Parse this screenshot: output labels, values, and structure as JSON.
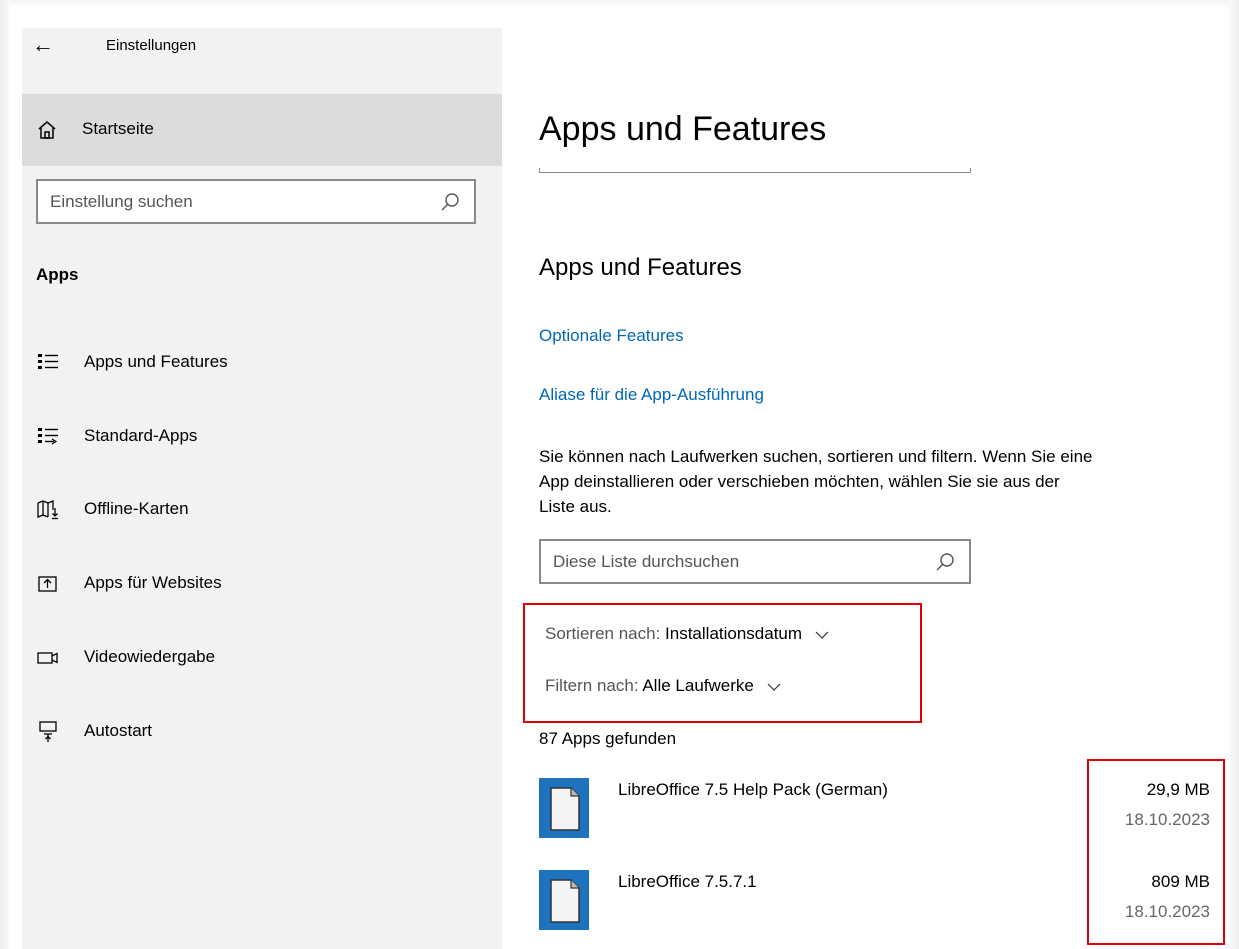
{
  "window": {
    "title": "Einstellungen",
    "back_glyph": "←"
  },
  "sidebar": {
    "home_label": "Startseite",
    "search_placeholder": "Einstellung suchen",
    "section_label": "Apps",
    "items": [
      {
        "label": "Apps und Features",
        "icon": "apps-features-icon",
        "selected": true
      },
      {
        "label": "Standard-Apps",
        "icon": "default-apps-icon"
      },
      {
        "label": "Offline-Karten",
        "icon": "offline-maps-icon"
      },
      {
        "label": "Apps für Websites",
        "icon": "apps-websites-icon"
      },
      {
        "label": "Videowiedergabe",
        "icon": "video-playback-icon"
      },
      {
        "label": "Autostart",
        "icon": "startup-icon"
      }
    ]
  },
  "main": {
    "page_title": "Apps und Features",
    "section_title": "Apps und Features",
    "links": {
      "optional_features": "Optionale Features",
      "app_aliases": "Aliase für die App-Ausführung"
    },
    "description_line1": "Sie können nach Laufwerken suchen, sortieren und filtern. Wenn Sie eine",
    "description_line2": "App deinstallieren oder verschieben möchten, wählen Sie sie aus der",
    "description_line3": "Liste aus.",
    "list_search_placeholder": "Diese Liste durchsuchen",
    "sort": {
      "label": "Sortieren nach:",
      "value": "Installationsdatum"
    },
    "filter": {
      "label": "Filtern nach:",
      "value": "Alle Laufwerke"
    },
    "apps_found": "87 Apps gefunden",
    "apps": [
      {
        "name": "LibreOffice 7.5 Help Pack (German)",
        "size": "29,9 MB",
        "date": "18.10.2023"
      },
      {
        "name": "LibreOffice 7.5.7.1",
        "size": "809 MB",
        "date": "18.10.2023"
      }
    ]
  },
  "colors": {
    "link": "#0067b8",
    "highlight_box": "#e0000a",
    "sidebar_bg": "#f2f2f2",
    "selected_bg": "#dcdcdc",
    "app_icon": "#1e73be"
  }
}
